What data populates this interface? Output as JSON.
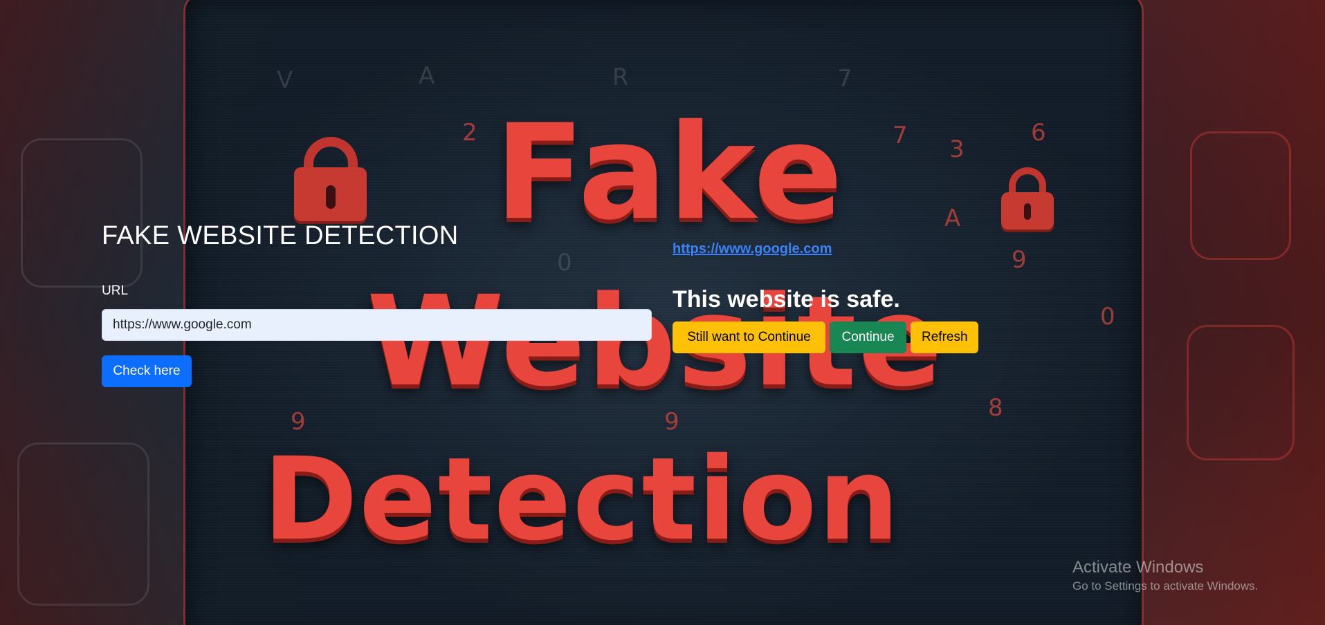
{
  "background": {
    "headline_words": [
      "Fake",
      "Website",
      "Detection"
    ]
  },
  "form": {
    "title": "FAKE WEBSITE DETECTION",
    "url_label": "URL",
    "url_value": "https://www.google.com",
    "check_button": "Check here"
  },
  "result": {
    "link_text": "https://www.google.com",
    "message": "This website is safe.",
    "buttons": {
      "still_continue": "Still want to Continue",
      "continue": "Continue",
      "refresh": "Refresh"
    }
  },
  "watermark": {
    "title": "Activate Windows",
    "subtitle": "Go to Settings to activate Windows."
  },
  "colors": {
    "primary": "#0d6efd",
    "warning": "#ffc107",
    "success": "#198754",
    "headline_red": "#e8463c"
  }
}
